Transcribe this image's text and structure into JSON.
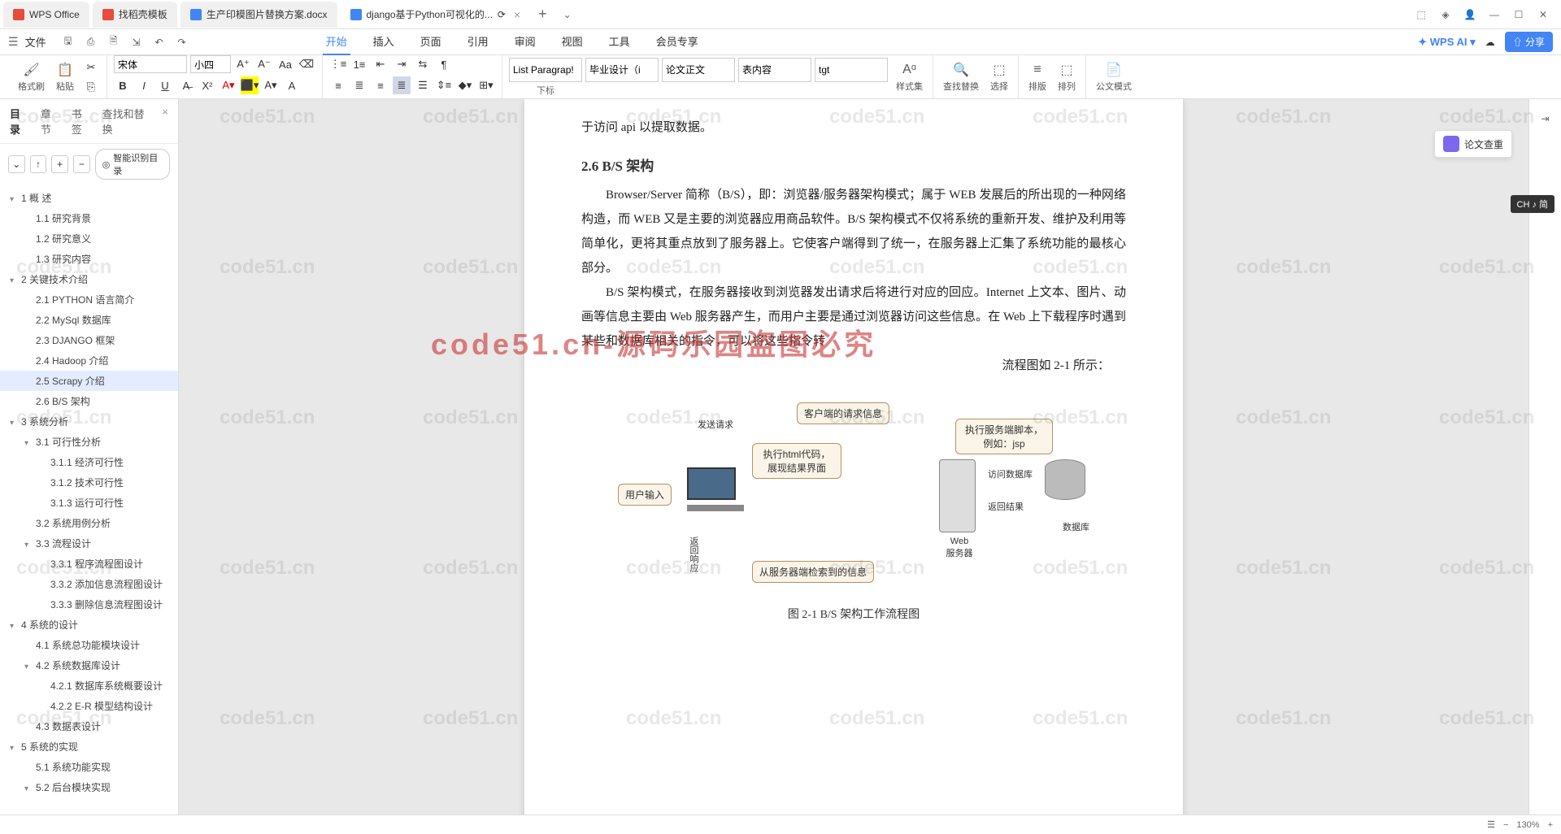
{
  "tabs": [
    {
      "label": "WPS Office",
      "icon": "red"
    },
    {
      "label": "找稻壳模板",
      "icon": "red"
    },
    {
      "label": "生产印模图片替换方案.docx",
      "icon": "blue"
    },
    {
      "label": "django基于Python可视化的...",
      "icon": "blue",
      "active": true
    }
  ],
  "menu": {
    "file": "文件",
    "tabs": [
      "开始",
      "插入",
      "页面",
      "引用",
      "审阅",
      "视图",
      "工具",
      "会员专享"
    ],
    "active_tab": "开始",
    "wps_ai": "WPS AI",
    "share": "分享"
  },
  "toolbar": {
    "format_brush": "格式刷",
    "paste": "粘贴",
    "font_name": "宋体",
    "font_size": "小四",
    "styles": {
      "s1": "List Paragrap!",
      "s1_label": "下标",
      "s2": "毕业设计（i",
      "s3": "论文正文",
      "s4": "表内容",
      "s5": "tgt"
    },
    "style_set": "样式集",
    "find_replace": "查找替换",
    "select": "选择",
    "sort": "排版",
    "arrange": "排列",
    "gov_mode": "公文模式"
  },
  "sidebar": {
    "tabs": [
      "目录",
      "章节",
      "书签",
      "查找和替换"
    ],
    "active": "目录",
    "smart": "智能识别目录",
    "items": [
      {
        "level": 1,
        "text": "1  概    述",
        "arrow": true
      },
      {
        "level": 2,
        "text": "1.1 研究背景"
      },
      {
        "level": 2,
        "text": "1.2 研究意义"
      },
      {
        "level": 2,
        "text": "1.3 研究内容"
      },
      {
        "level": 1,
        "text": "2  关键技术介绍",
        "arrow": true
      },
      {
        "level": 2,
        "text": "2.1 PYTHON 语言简介"
      },
      {
        "level": 2,
        "text": "2.2 MySql 数据库"
      },
      {
        "level": 2,
        "text": "2.3 DJANGO 框架"
      },
      {
        "level": 2,
        "text": "2.4 Hadoop 介绍"
      },
      {
        "level": 2,
        "text": "2.5 Scrapy 介绍",
        "active": true
      },
      {
        "level": 2,
        "text": "2.6 B/S 架构"
      },
      {
        "level": 1,
        "text": "3  系统分析",
        "arrow": true
      },
      {
        "level": 2,
        "text": "3.1  可行性分析",
        "arrow": true
      },
      {
        "level": 3,
        "text": "3.1.1 经济可行性"
      },
      {
        "level": 3,
        "text": "3.1.2 技术可行性"
      },
      {
        "level": 3,
        "text": "3.1.3 运行可行性"
      },
      {
        "level": 2,
        "text": "3.2 系统用例分析"
      },
      {
        "level": 2,
        "text": "3.3 流程设计",
        "arrow": true
      },
      {
        "level": 3,
        "text": "3.3.1 程序流程图设计"
      },
      {
        "level": 3,
        "text": "3.3.2 添加信息流程图设计"
      },
      {
        "level": 3,
        "text": "3.3.3 删除信息流程图设计"
      },
      {
        "level": 1,
        "text": "4  系统的设计",
        "arrow": true
      },
      {
        "level": 2,
        "text": "4.1 系统总功能模块设计"
      },
      {
        "level": 2,
        "text": "4.2 系统数据库设计",
        "arrow": true
      },
      {
        "level": 3,
        "text": "4.2.1 数据库系统概要设计"
      },
      {
        "level": 3,
        "text": "4.2.2 E-R 模型结构设计"
      },
      {
        "level": 2,
        "text": "4.3 数据表设计"
      },
      {
        "level": 1,
        "text": "5  系统的实现",
        "arrow": true
      },
      {
        "level": 2,
        "text": "5.1 系统功能实现"
      },
      {
        "level": 2,
        "text": "5.2 后台模块实现",
        "arrow": true
      }
    ]
  },
  "document": {
    "line0": "于访问 api 以提取数据。",
    "heading": "2.6 B/S 架构",
    "para1": "Browser/Server 简称（B/S），即：浏览器/服务器架构模式；属于 WEB 发展后的所出现的一种网络构造，而 WEB 又是主要的浏览器应用商品软件。B/S 架构模式不仅将系统的重新开发、维护及利用等简单化，更将其重点放到了服务器上。它使客户端得到了统一，在服务器上汇集了系统功能的最核心部分。",
    "para2": "B/S 架构模式，在服务器接收到浏览器发出请求后将进行对应的回应。Internet 上文本、图片、动画等信息主要由 Web 服务器产生，而用户主要是通过浏览器访问这些信息。在 Web 上下载程序时遇到某些和数据库相关的指令，可以将这些指令转",
    "para3": "流程图如 2-1 所示：",
    "caption": "图 2-1 B/S 架构工作流程图",
    "diagram": {
      "user_input": "用户输入",
      "send_request": "发送请求",
      "client_info": "客户端的请求信息",
      "exec_html": "执行html代码，展现结果界面",
      "exec_script": "执行服务端脚本，例如：jsp",
      "access_db": "访问数据库",
      "return_result": "返回结果",
      "return_response": "返回响应",
      "retrieve_info": "从服务器端检索到的信息",
      "web_server": "Web\n服务器",
      "database": "数据库"
    }
  },
  "right": {
    "paper_check": "论文查重"
  },
  "ime": "CH ♪ 简",
  "watermark": "code51.cn",
  "watermark_big": "code51.cn-源码乐园盗图必究",
  "status": {
    "zoom": "130%"
  }
}
